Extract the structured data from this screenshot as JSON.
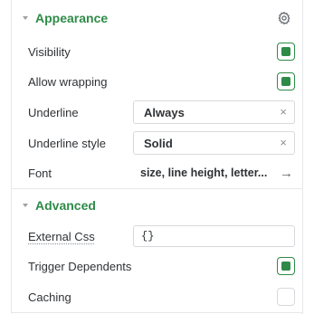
{
  "appearance": {
    "title": "Appearance",
    "settings_icon": "gear-icon",
    "visibility_label": "Visibility",
    "visibility_checked": true,
    "wrapping_label": "Allow wrapping",
    "wrapping_checked": true,
    "underline_label": "Underline",
    "underline_value": "Always",
    "underline_style_label": "Underline style",
    "underline_style_value": "Solid",
    "clear_symbol": "×",
    "font_label": "Font",
    "font_value": "size, line height, letter...",
    "font_arrow": "→"
  },
  "advanced": {
    "title": "Advanced",
    "external_css_label": "External Css",
    "external_css_value": "{}",
    "trigger_label": "Trigger Dependents",
    "trigger_checked": true,
    "caching_label": "Caching",
    "caching_checked": false
  },
  "colors": {
    "accent": "#2e8b47",
    "border": "#d7d9dc",
    "text": "#2f3235"
  }
}
